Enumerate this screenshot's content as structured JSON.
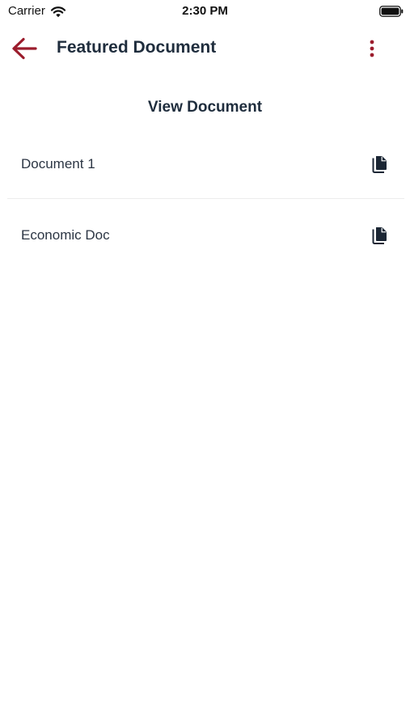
{
  "status_bar": {
    "carrier": "Carrier",
    "time": "2:30 PM",
    "icons": [
      "wifi-icon",
      "battery-icon"
    ]
  },
  "header": {
    "title": "Featured Document",
    "back_icon": "arrow-left-icon",
    "menu_icon": "vertical-dots-icon"
  },
  "section": {
    "title": "View Document"
  },
  "documents": [
    {
      "name": "Document 1",
      "icon": "copy-document-icon"
    },
    {
      "name": "Economic Doc",
      "icon": "copy-document-icon"
    }
  ],
  "colors": {
    "accent": "#9b1c2c",
    "title_text": "#1f2d3d",
    "body_text": "#2c3644",
    "divider": "#ececec",
    "icon_dark": "#1b2634"
  }
}
